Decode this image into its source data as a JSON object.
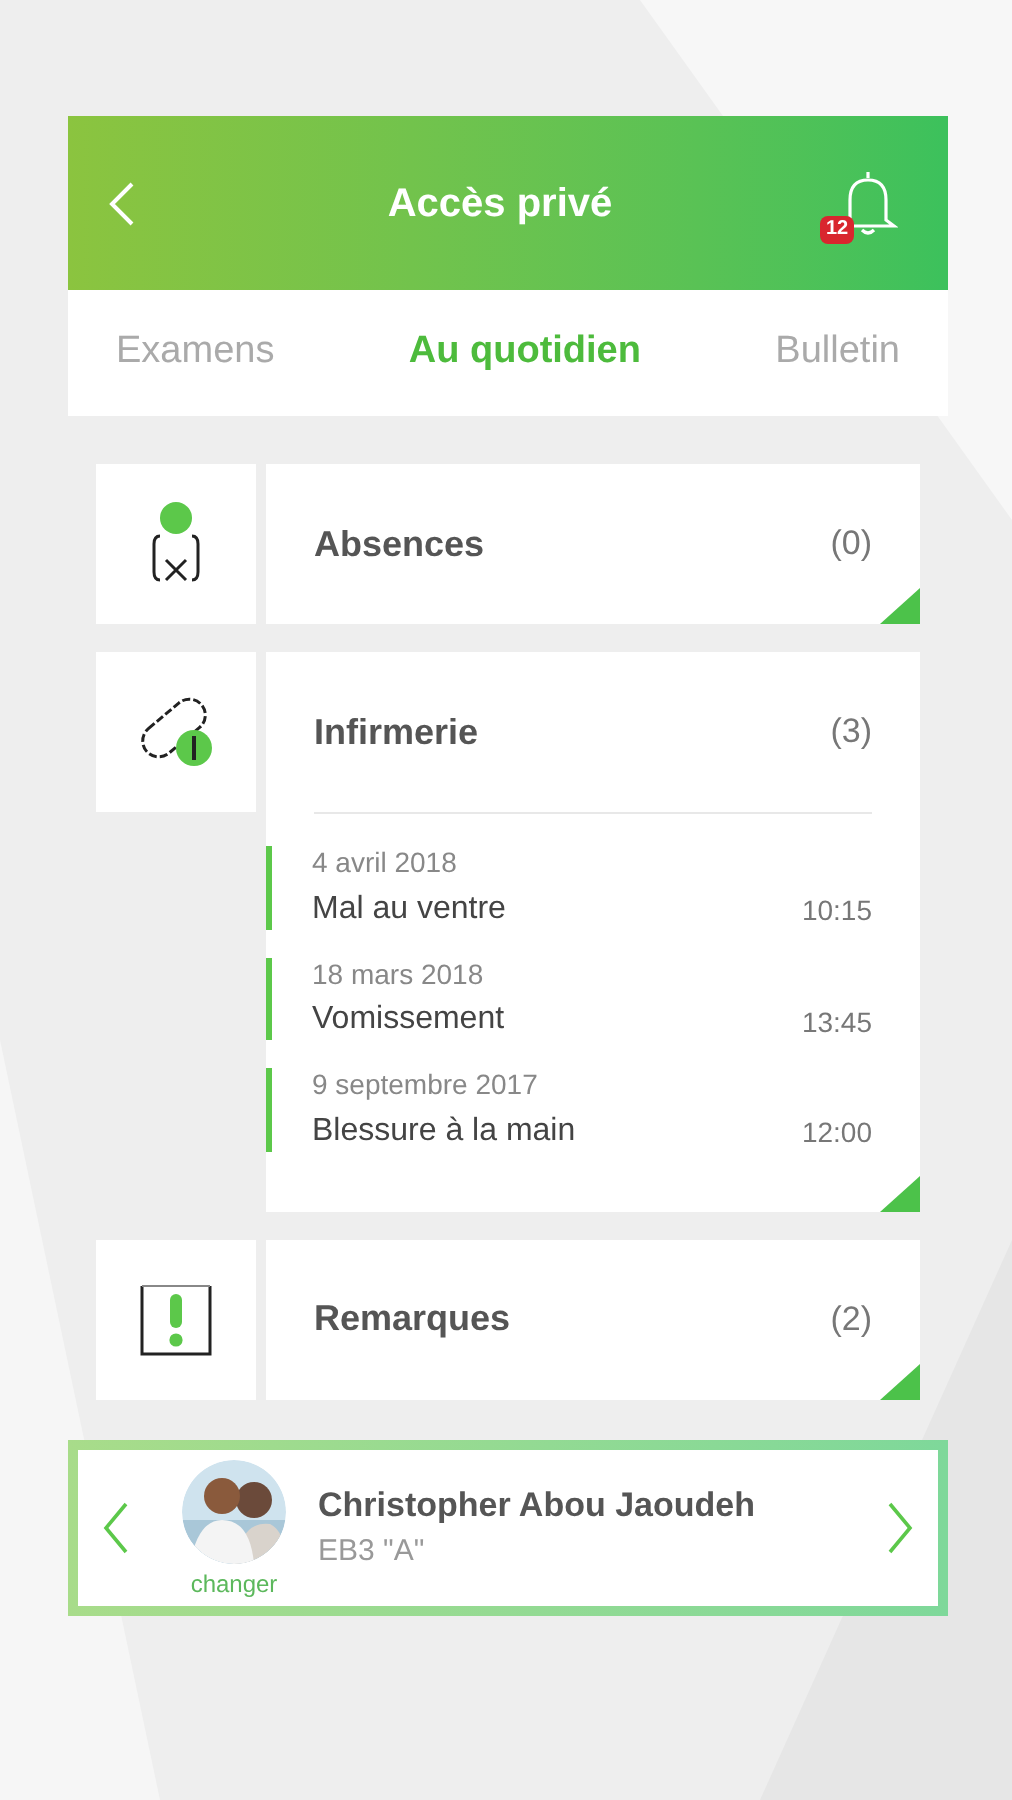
{
  "header": {
    "title": "Accès privé",
    "badge": "12"
  },
  "tabs": [
    {
      "label": "Examens",
      "selected": false
    },
    {
      "label": "Au quotidien",
      "selected": true
    },
    {
      "label": "Bulletin",
      "selected": false
    }
  ],
  "sections": [
    {
      "title": "Absences",
      "count": "(0)",
      "expanded": false
    },
    {
      "title": "Infirmerie",
      "count": "(3)",
      "expanded": true,
      "entries": [
        {
          "date": "4 avril 2018",
          "label": "Mal au ventre",
          "time": "10:15"
        },
        {
          "date": "18 mars 2018",
          "label": "Vomissement",
          "time": "13:45"
        },
        {
          "date": "9 septembre 2017",
          "label": "Blessure à la main",
          "time": "12:00"
        }
      ]
    },
    {
      "title": "Remarques",
      "count": "(2)",
      "expanded": false
    }
  ],
  "student": {
    "name": "Christopher Abou Jaoudeh",
    "class": "EB3 \"A\"",
    "change_label": "changer"
  }
}
